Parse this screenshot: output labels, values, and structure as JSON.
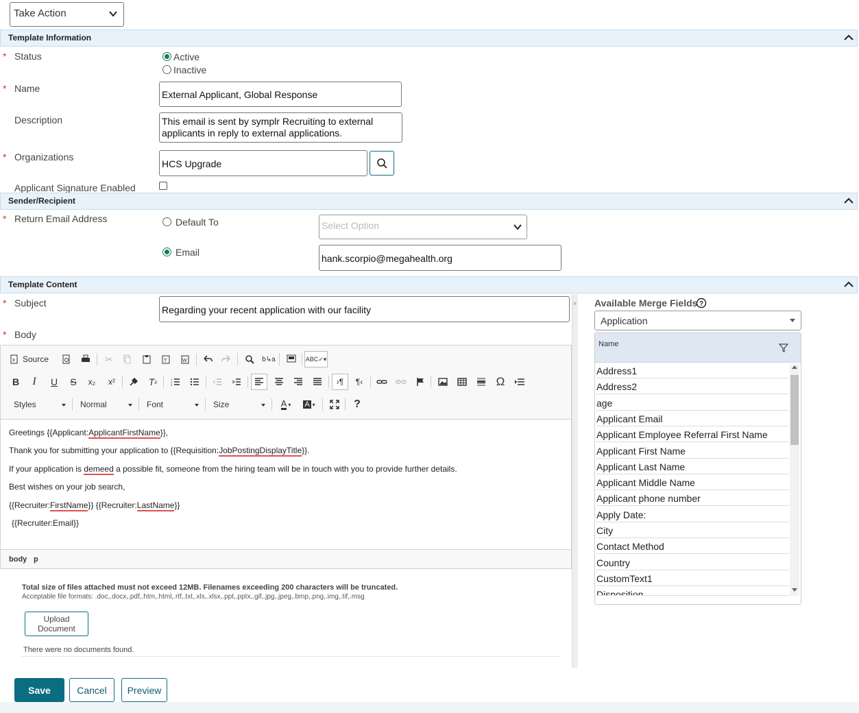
{
  "take_action": {
    "label": "Take Action"
  },
  "sections": {
    "template_information": "Template Information",
    "sender_recipient": "Sender/Recipient",
    "template_content": "Template Content"
  },
  "status": {
    "label": "Status",
    "options": [
      "Active",
      "Inactive"
    ],
    "selected": "Active"
  },
  "name": {
    "label": "Name",
    "value": "External Applicant, Global Response"
  },
  "description": {
    "label": "Description",
    "value": "This email is sent by symplr Recruiting to external applicants in reply to external applications."
  },
  "organizations": {
    "label": "Organizations",
    "value": "HCS Upgrade"
  },
  "signature": {
    "label": "Applicant Signature Enabled"
  },
  "return_email": {
    "label": "Return Email Address",
    "default_to_label": "Default To",
    "select_placeholder": "Select Option",
    "email_label": "Email",
    "email_value": "hank.scorpio@megahealth.org",
    "selected": "Email"
  },
  "subject": {
    "label": "Subject",
    "value": "Regarding your recent application with our facility"
  },
  "body_label": "Body",
  "editor": {
    "source_label": "Source",
    "styles_label": "Styles",
    "format_label": "Normal",
    "font_label": "Font",
    "size_label": "Size",
    "lines": {
      "l1_pre": "Greetings {{Applicant:",
      "l1_field": "ApplicantFirstName",
      "l1_post": "}},",
      "l2_pre": "Thank you for submitting your application to {{Requisition:",
      "l2_field": "JobPostingDisplayTitle",
      "l2_post": "}}.",
      "l3_pre": "If your application is ",
      "l3_word": "demeed",
      "l3_post": " a possible fit, someone from the hiring team will be in touch with you to provide further details.",
      "l4": "Best wishes on your job search,",
      "l5_a": "{{Recruiter:",
      "l5_b": "FirstName",
      "l5_c": "}} {{Recruiter:",
      "l5_d": "LastName",
      "l5_e": "}}",
      "l6": "{{Recruiter:Email}}"
    },
    "path": [
      "body",
      "p"
    ]
  },
  "attachments": {
    "note": "Total size of files attached must not exceed 12MB. Filenames exceeding 200 characters will be truncated.",
    "formats": "Acceptable file formats: .doc,.docx,.pdf,.htm,.html,.rtf,.txt,.xls,.xlsx,.ppt,.pptx,.gif,.jpg,.jpeg,.bmp,.png,.img,.tif,.msg",
    "upload_label_1": "Upload",
    "upload_label_2": "Document",
    "empty": "There were no documents found."
  },
  "merge_fields": {
    "title": "Available Merge Fields",
    "category": "Application",
    "column": "Name",
    "items": [
      "Address1",
      "Address2",
      "age",
      "Applicant Email",
      "Applicant Employee Referral First Name",
      "Applicant First Name",
      "Applicant Last Name",
      "Applicant Middle Name",
      "Applicant phone number",
      "Apply Date:",
      "City",
      "Contact Method",
      "Country",
      "CustomText1",
      "Disposition"
    ]
  },
  "footer": {
    "save": "Save",
    "cancel": "Cancel",
    "preview": "Preview"
  },
  "colors": {
    "accent": "#0b6e80",
    "section_bg": "#e8f2fb",
    "required": "#c0392b"
  }
}
